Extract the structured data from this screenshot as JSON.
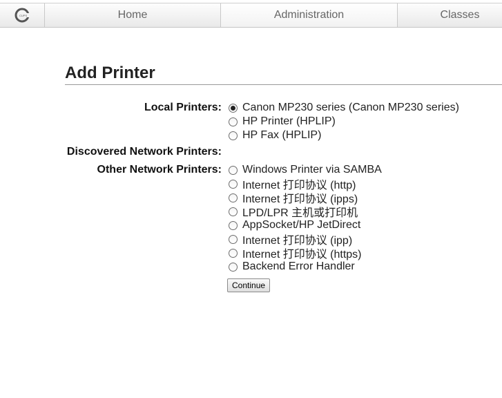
{
  "nav": {
    "logo_icon": "cups-logo-icon",
    "tabs": [
      {
        "label": "Home",
        "active": false
      },
      {
        "label": "Administration",
        "active": true
      },
      {
        "label": "Classes",
        "active": false
      }
    ]
  },
  "page": {
    "title": "Add Printer"
  },
  "form": {
    "local_label": "Local Printers:",
    "local_options": [
      "Canon MP230 series (Canon MP230 series)",
      "HP Printer (HPLIP)",
      "HP Fax (HPLIP)"
    ],
    "selected_option": "Canon MP230 series (Canon MP230 series)",
    "discovered_label": "Discovered Network Printers:",
    "other_label": "Other Network Printers:",
    "other_options": [
      "Windows Printer via SAMBA",
      "Internet 打印协议 (http)",
      "Internet 打印协议 (ipps)",
      "LPD/LPR 主机或打印机",
      "AppSocket/HP JetDirect",
      "Internet 打印协议 (ipp)",
      "Internet 打印协议 (https)",
      "Backend Error Handler"
    ],
    "continue_label": "Continue"
  }
}
